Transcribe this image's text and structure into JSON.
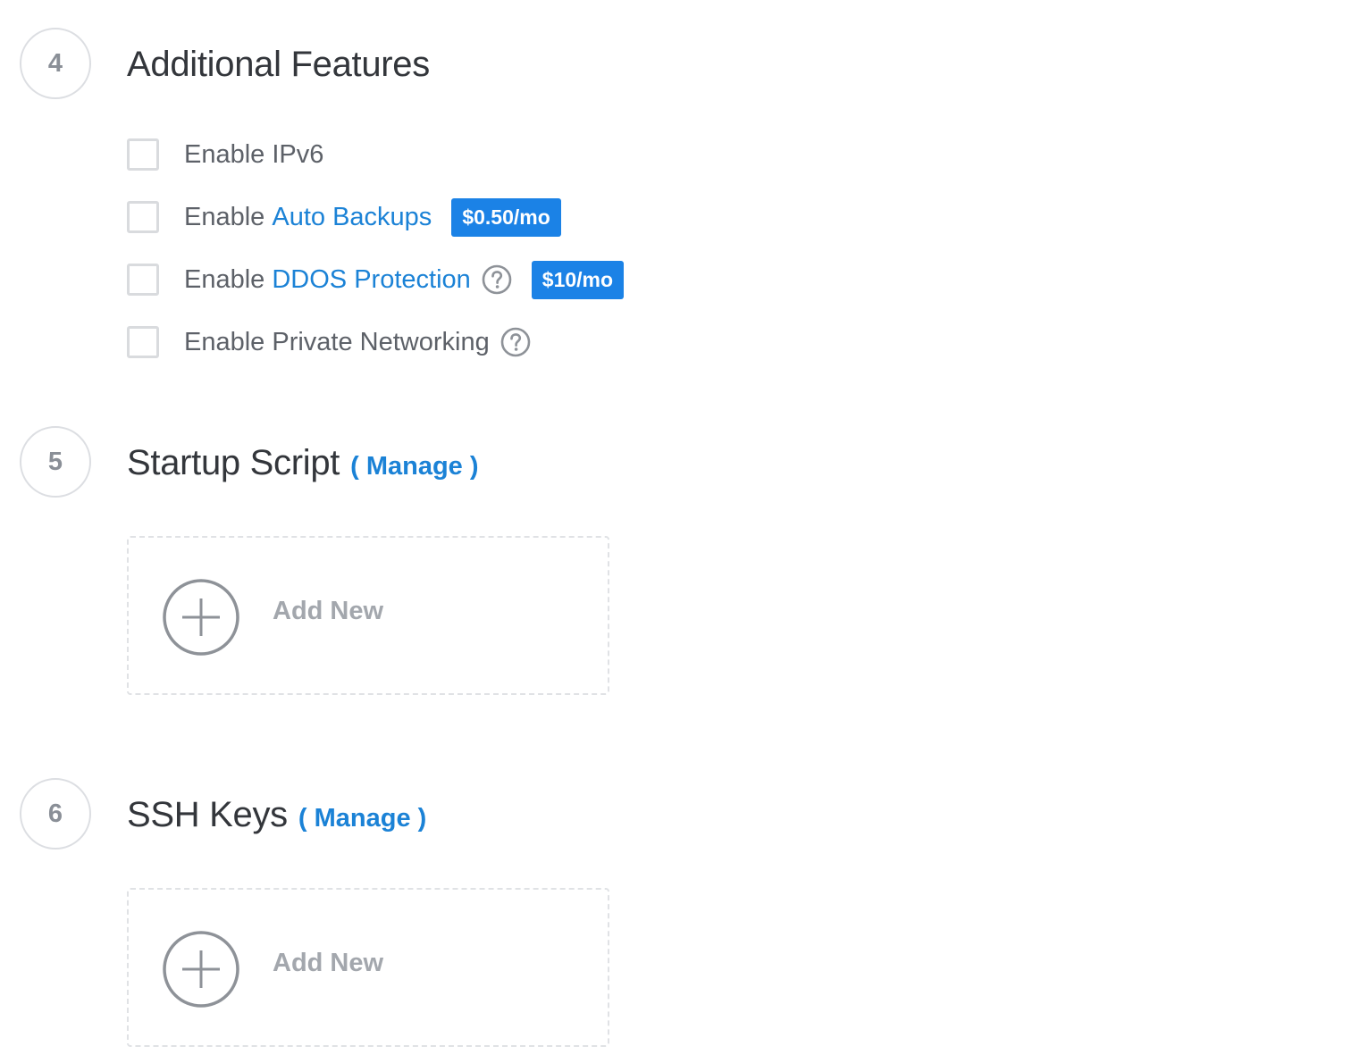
{
  "sections": {
    "features": {
      "step": "4",
      "title": "Additional Features",
      "items": {
        "ipv6": {
          "prefix": "Enable IPv6"
        },
        "backups": {
          "prefix": "Enable ",
          "link": "Auto Backups",
          "price": "$0.50/mo"
        },
        "ddos": {
          "prefix": "Enable ",
          "link": "DDOS Protection",
          "price": "$10/mo"
        },
        "private": {
          "prefix": "Enable Private Networking"
        }
      }
    },
    "startup": {
      "step": "5",
      "title": "Startup Script",
      "manage": "( Manage )",
      "add_label": "Add New"
    },
    "ssh": {
      "step": "6",
      "title": "SSH Keys",
      "manage": "( Manage )",
      "add_label": "Add New"
    }
  },
  "colors": {
    "accent": "#1b82d6",
    "badge": "#1b82e6",
    "muted": "#a3a7ad",
    "border": "#dcdee2"
  },
  "icons": {
    "help": "question-circle-icon",
    "add": "plus-circle-icon"
  }
}
